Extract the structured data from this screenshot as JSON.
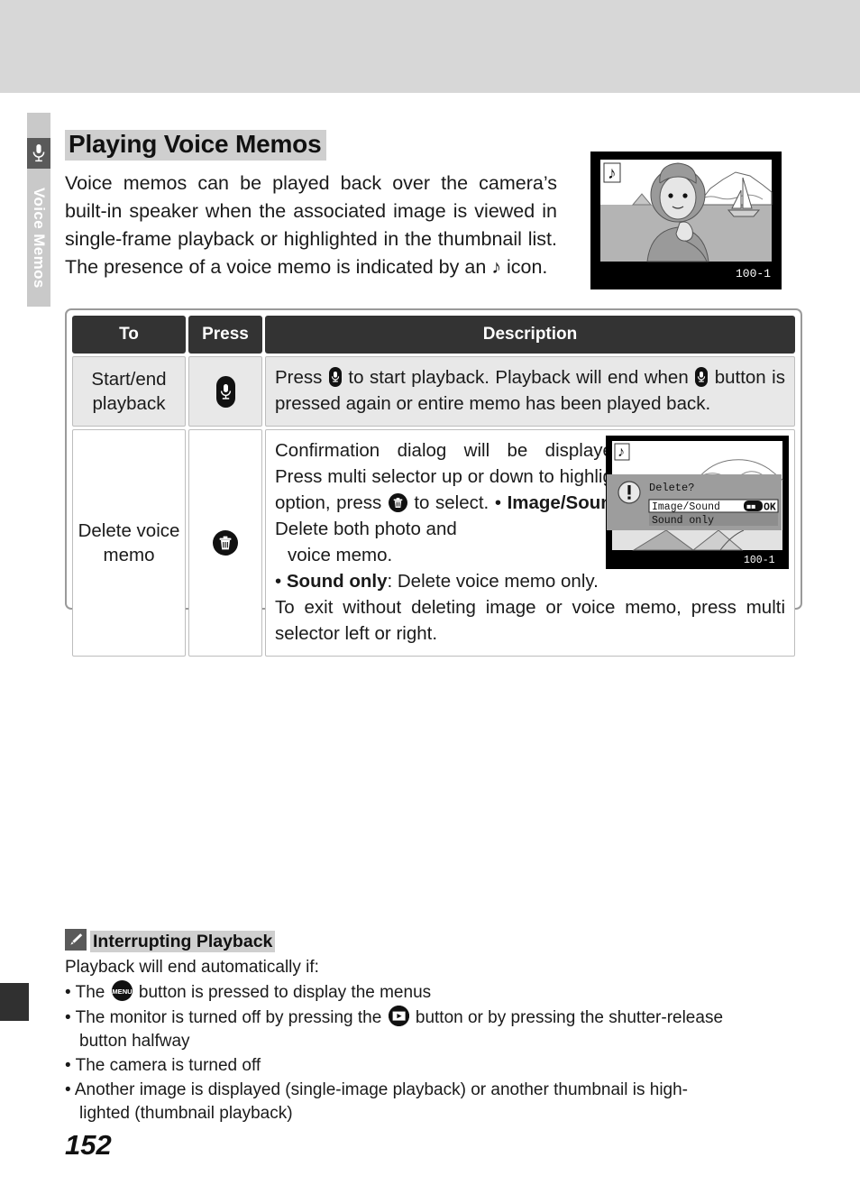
{
  "page": {
    "number": "152",
    "side_tab_label": "Voice Memos",
    "side_tab_icon": "microphone-icon"
  },
  "heading": "Playing Voice Memos",
  "intro": "Voice memos can be played back over the camera’s built-in speaker when the associated image is viewed in single-frame playback or highlighted in the thumbnail list.  The presence of a voice memo is indicated by an ♪ icon.",
  "camera_shot": {
    "memo_badge": "note-icon",
    "frame_number": "100-1"
  },
  "table": {
    "headers": [
      "To",
      "Press",
      "Description"
    ],
    "rows": [
      {
        "to": "Start/end playback",
        "press_icon": "microphone-button-icon",
        "desc_part1": "Press ",
        "desc_part2": " to start playback.  Playback will end when ",
        "desc_part3": " button is pressed again or entire memo has been played back."
      },
      {
        "to": "Delete voice memo",
        "press_icon": "trash-button-icon",
        "desc_line1a": "Confirmation dialog will be displayed. Press multi selector up or down to highlight option, press ",
        "desc_line1b": " to select.",
        "bullet1_label": "Image/Sound",
        "bullet1_text": ": Delete both photo and",
        "bullet1_cont": "voice memo.",
        "bullet2_label": "Sound only",
        "bullet2_text": ": Delete voice memo only.",
        "desc_last": "To exit without deleting image or voice memo, press multi selector left or right."
      }
    ]
  },
  "dialog_shot": {
    "memo_badge": "note-icon",
    "warning_icon": "exclamation-icon",
    "title": "Delete?",
    "option_selected": "Image/Sound",
    "option_other": "Sound only",
    "ok_label": "OK",
    "frame_number": "100-1"
  },
  "note": {
    "icon": "pencil-icon",
    "title": "Interrupting Playback",
    "lead": "Playback will end automatically if:",
    "items": [
      {
        "pre": "• The ",
        "icon": "menu-button-icon",
        "post": " button is pressed to display the menus"
      },
      {
        "pre": "• The monitor is turned off by pressing the ",
        "icon": "playback-button-icon",
        "post": " button or by pressing the shutter-release",
        "cont": "button halfway"
      },
      {
        "pre": "• The camera is turned off",
        "icon": null,
        "post": ""
      },
      {
        "pre": "• Another image is displayed (single-image playback) or another thumbnail is high-",
        "icon": null,
        "post": "",
        "cont": "lighted (thumbnail playback)"
      }
    ]
  },
  "colors": {
    "banner": "#d7d7d7",
    "tab_bg": "#c9c9c9",
    "tab_icon_bg": "#5a5a5a",
    "header_cell": "#333333",
    "row_shade": "#e8e8e8",
    "highlight": "#cfcfcf"
  }
}
